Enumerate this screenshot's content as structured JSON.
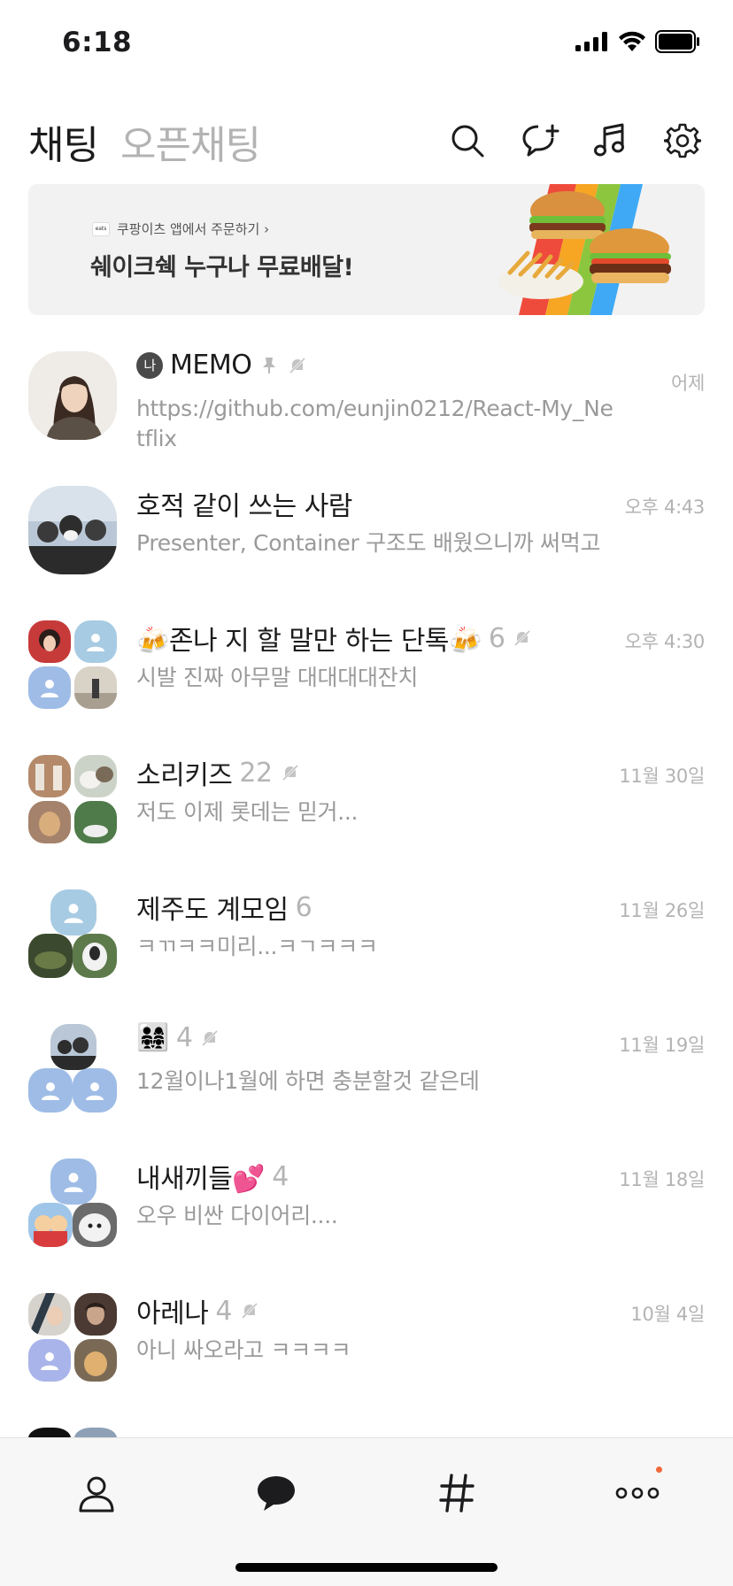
{
  "status_bar": {
    "time": "6:18"
  },
  "header": {
    "tab_chat": "채팅",
    "tab_open_chat": "오픈채팅",
    "icons": [
      "search-icon",
      "new-chat-icon",
      "music-icon",
      "settings-icon"
    ]
  },
  "banner": {
    "small_text": "쿠팡이츠 앱에서 주문하기 ›",
    "logo_text": "eats",
    "title": "쉐이크쉑 누구나 무료배달!"
  },
  "chats": [
    {
      "title": "MEMO",
      "badge": "나",
      "count": "",
      "preview": "https://github.com/eunjin0212/React-My_Netflix",
      "time": "어제",
      "pinned": true,
      "muted": true
    },
    {
      "title": "호적 같이 쓰는 사람",
      "count": "",
      "preview": "Presenter, Container 구조도 배웠으니까 써먹고",
      "time": "오후 4:43",
      "muted": false
    },
    {
      "title": "🍻존나 지 할  말만 하는 단톡🍻",
      "count": "6",
      "preview": "시발 진짜 아무말 대대대대잔치",
      "time": "오후 4:30",
      "muted": true
    },
    {
      "title": "소리키즈",
      "count": "22",
      "preview": "저도 이제 롯데는 믿거...",
      "time": "11월 30일",
      "muted": true
    },
    {
      "title": "제주도 계모임",
      "count": "6",
      "preview": "ㅋㄲㅋㅋ미리...ㅋㄱㅋㅋㅋ",
      "time": "11월 26일",
      "muted": false
    },
    {
      "title": "👨‍👩‍👧‍👧",
      "count": "4",
      "preview": "12월이나1월에 하면 충분할것 같은데",
      "time": "11월 19일",
      "muted": true
    },
    {
      "title": "내새끼들💕",
      "count": "4",
      "preview": "오우 비싼 다이어리....",
      "time": "11월 18일",
      "muted": false
    },
    {
      "title": "아레나",
      "count": "4",
      "preview": "아니 싸오라고 ㅋㅋㅋㅋ",
      "time": "10월 4일",
      "muted": true
    }
  ],
  "tabbar": {
    "items": [
      "friends-icon",
      "chats-icon",
      "view-icon",
      "more-icon"
    ],
    "notification_color": "#f2683b"
  },
  "colors": {
    "muted_text": "#9a9a9a",
    "time_text": "#b3b3b3",
    "placeholder_avatar": "#a7cbe3"
  }
}
